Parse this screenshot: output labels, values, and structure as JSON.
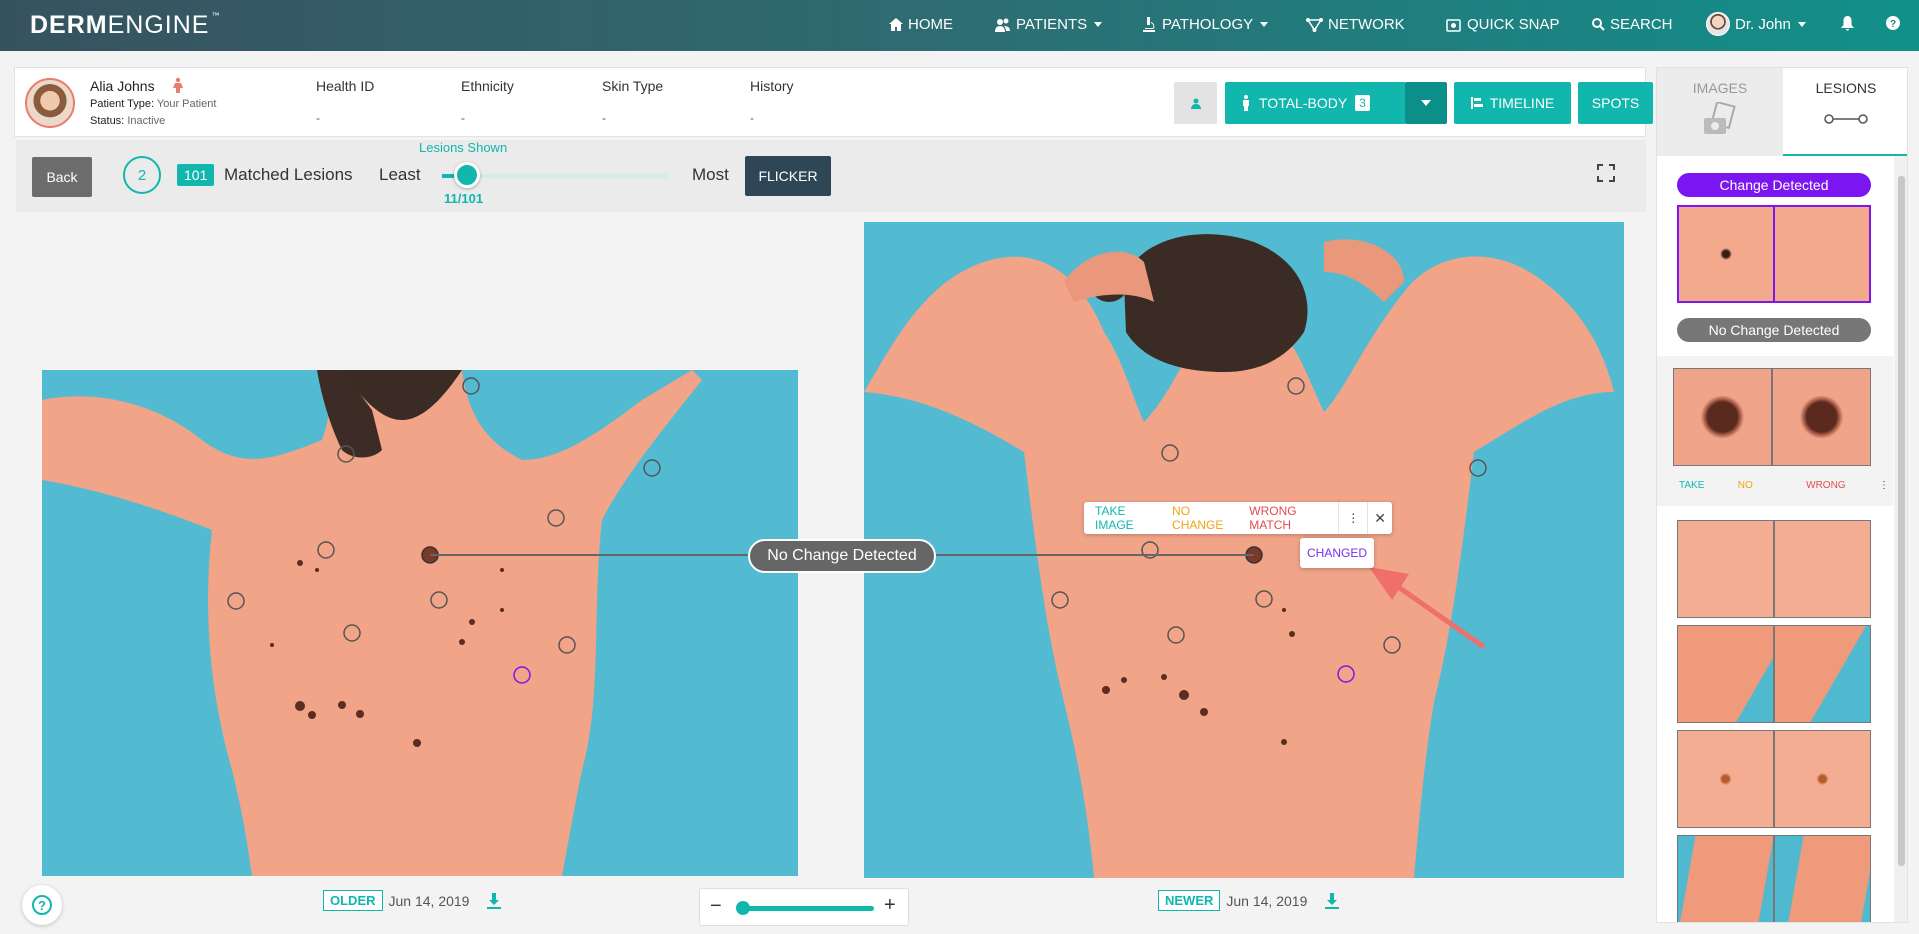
{
  "nav": {
    "logo_bold": "DERM",
    "logo_light": "ENGINE",
    "logo_tm": "™",
    "items": [
      {
        "label": "HOME",
        "icon": "home-icon"
      },
      {
        "label": "PATIENTS",
        "icon": "users-icon"
      },
      {
        "label": "PATHOLOGY",
        "icon": "microscope-icon"
      },
      {
        "label": "NETWORK",
        "icon": "network-icon"
      },
      {
        "label": "QUICK SNAP",
        "icon": "camera-icon"
      },
      {
        "label": "SEARCH",
        "icon": "search-icon"
      }
    ],
    "user": "Dr. John",
    "bell_icon": "bell-icon",
    "help_icon": "question-icon"
  },
  "patient": {
    "name": "Alia Johns",
    "type_label": "Patient Type:",
    "type_value": "Your Patient",
    "status_label": "Status:",
    "status_value": "Inactive",
    "columns": [
      {
        "header": "Health ID",
        "value": "-"
      },
      {
        "header": "Ethnicity",
        "value": "-"
      },
      {
        "header": "Skin Type",
        "value": "-"
      },
      {
        "header": "History",
        "value": "-"
      }
    ]
  },
  "actions": {
    "total_body": "TOTAL-BODY",
    "total_body_count": "3",
    "timeline": "TIMELINE",
    "spots": "SPOTS"
  },
  "toolbar": {
    "back": "Back",
    "step": "2",
    "matched_count": "101",
    "matched_label": "Matched Lesions",
    "least": "Least",
    "most": "Most",
    "lesions_shown_label": "Lesions Shown",
    "lesions_shown_value": "11/101",
    "lesions_shown_fraction": 0.109,
    "flicker": "FLICKER"
  },
  "compare": {
    "badge": "No Change Detected",
    "popup": {
      "take_image": "TAKE IMAGE",
      "no_change": "NO CHANGE",
      "wrong_match": "WRONG MATCH",
      "menu": "⋮",
      "close": "✕",
      "changed": "CHANGED"
    },
    "older_tag": "OLDER",
    "older_date": "Jun 14, 2019",
    "newer_tag": "NEWER",
    "newer_date": "Jun 14, 2019"
  },
  "side": {
    "tab_images": "IMAGES",
    "tab_lesions": "LESIONS",
    "change_detected": "Change Detected",
    "no_change_detected": "No Change Detected",
    "take": "TAKE",
    "no": "NO",
    "wrong": "WRONG",
    "menu": "⋮"
  },
  "colors": {
    "teal": "#11b7ad",
    "purple": "#7b16f0",
    "dark": "#2f4656"
  }
}
